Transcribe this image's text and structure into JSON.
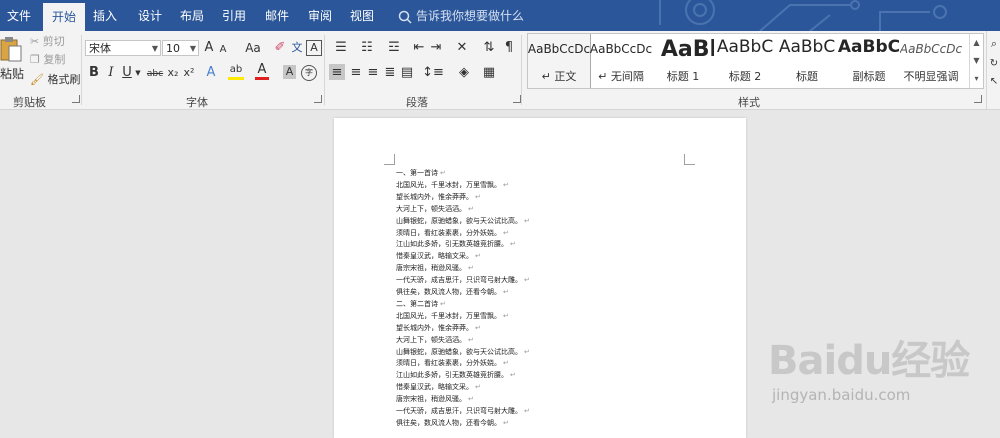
{
  "ribbon": {
    "tabs": [
      {
        "label": "文件",
        "active": false
      },
      {
        "label": "开始",
        "active": true
      },
      {
        "label": "插入",
        "active": false
      },
      {
        "label": "设计",
        "active": false
      },
      {
        "label": "布局",
        "active": false
      },
      {
        "label": "引用",
        "active": false
      },
      {
        "label": "邮件",
        "active": false
      },
      {
        "label": "审阅",
        "active": false
      },
      {
        "label": "视图",
        "active": false
      }
    ],
    "tell_me": "告诉我你想要做什么",
    "accent_color": "#2b579a"
  },
  "clipboard": {
    "paste": "粘贴",
    "cut": "剪切",
    "copy": "复制",
    "format_painter": "格式刷",
    "group_label": "剪贴板"
  },
  "font": {
    "family": "宋体",
    "size": "10",
    "grow": "A",
    "shrink": "A",
    "change_case": "Aa",
    "phonetic": "文",
    "border_char": "A",
    "bold": "B",
    "italic": "I",
    "underline": "U",
    "strike": "abc",
    "subscript": "x₂",
    "superscript": "x²",
    "text_effects": "A",
    "highlight": "ab",
    "font_color": "A",
    "shading": "A",
    "enclose": "字",
    "group_label": "字体"
  },
  "paragraph": {
    "group_label": "段落"
  },
  "styles": {
    "items": [
      {
        "sample": "AaBbCcDc",
        "name": "↵ 正文",
        "active": true,
        "size": 12,
        "bold": false,
        "italic": false
      },
      {
        "sample": "AaBbCcDc",
        "name": "↵ 无间隔",
        "active": false,
        "size": 12,
        "bold": false,
        "italic": false
      },
      {
        "sample": "AaBl",
        "name": "标题 1",
        "active": false,
        "size": 22,
        "bold": true,
        "italic": false
      },
      {
        "sample": "AaBbC",
        "name": "标题 2",
        "active": false,
        "size": 17,
        "bold": false,
        "italic": false
      },
      {
        "sample": "AaBbC",
        "name": "标题",
        "active": false,
        "size": 17,
        "bold": false,
        "italic": false
      },
      {
        "sample": "AaBbC",
        "name": "副标题",
        "active": false,
        "size": 17,
        "bold": true,
        "italic": false
      },
      {
        "sample": "AaBbCcDc",
        "name": "不明显强调",
        "active": false,
        "size": 12,
        "bold": false,
        "italic": true
      }
    ],
    "group_label": "样式"
  },
  "document": {
    "lines": [
      "一、第一首诗",
      "北国风光，千里冰封，万里雪飘。",
      "望长城内外，惟余莽莽。",
      "大河上下，顿失滔滔。",
      "山舞银蛇，原驰蜡象，欲与天公试比高。",
      "须晴日，看红装素裹，分外妖娆。",
      "江山如此多娇，引无数英雄竞折腰。",
      "惜秦皇汉武，略输文采。",
      "唐宗宋祖，稍逊风骚。",
      "一代天骄，成吉思汗，只识弯弓射大雕。",
      "俱往矣，数风流人物，还看今朝。",
      "二、第二首诗",
      "北国风光，千里冰封，万里雪飘。",
      "望长城内外，惟余莽莽。",
      "大河上下，顿失滔滔。",
      "山舞银蛇，原驰蜡象，欲与天公试比高。",
      "须晴日，看红装素裹，分外妖娆。",
      "江山如此多娇，引无数英雄竞折腰。",
      "惜秦皇汉武，略输文采。",
      "唐宗宋祖，稍逊风骚。",
      "一代天骄，成吉思汗，只识弯弓射大雕。",
      "俱往矣，数风流人物，还看今朝。"
    ],
    "paragraph_mark": "↵"
  },
  "watermark": {
    "logo": "Baidu经验",
    "url": "jingyan.baidu.com"
  }
}
